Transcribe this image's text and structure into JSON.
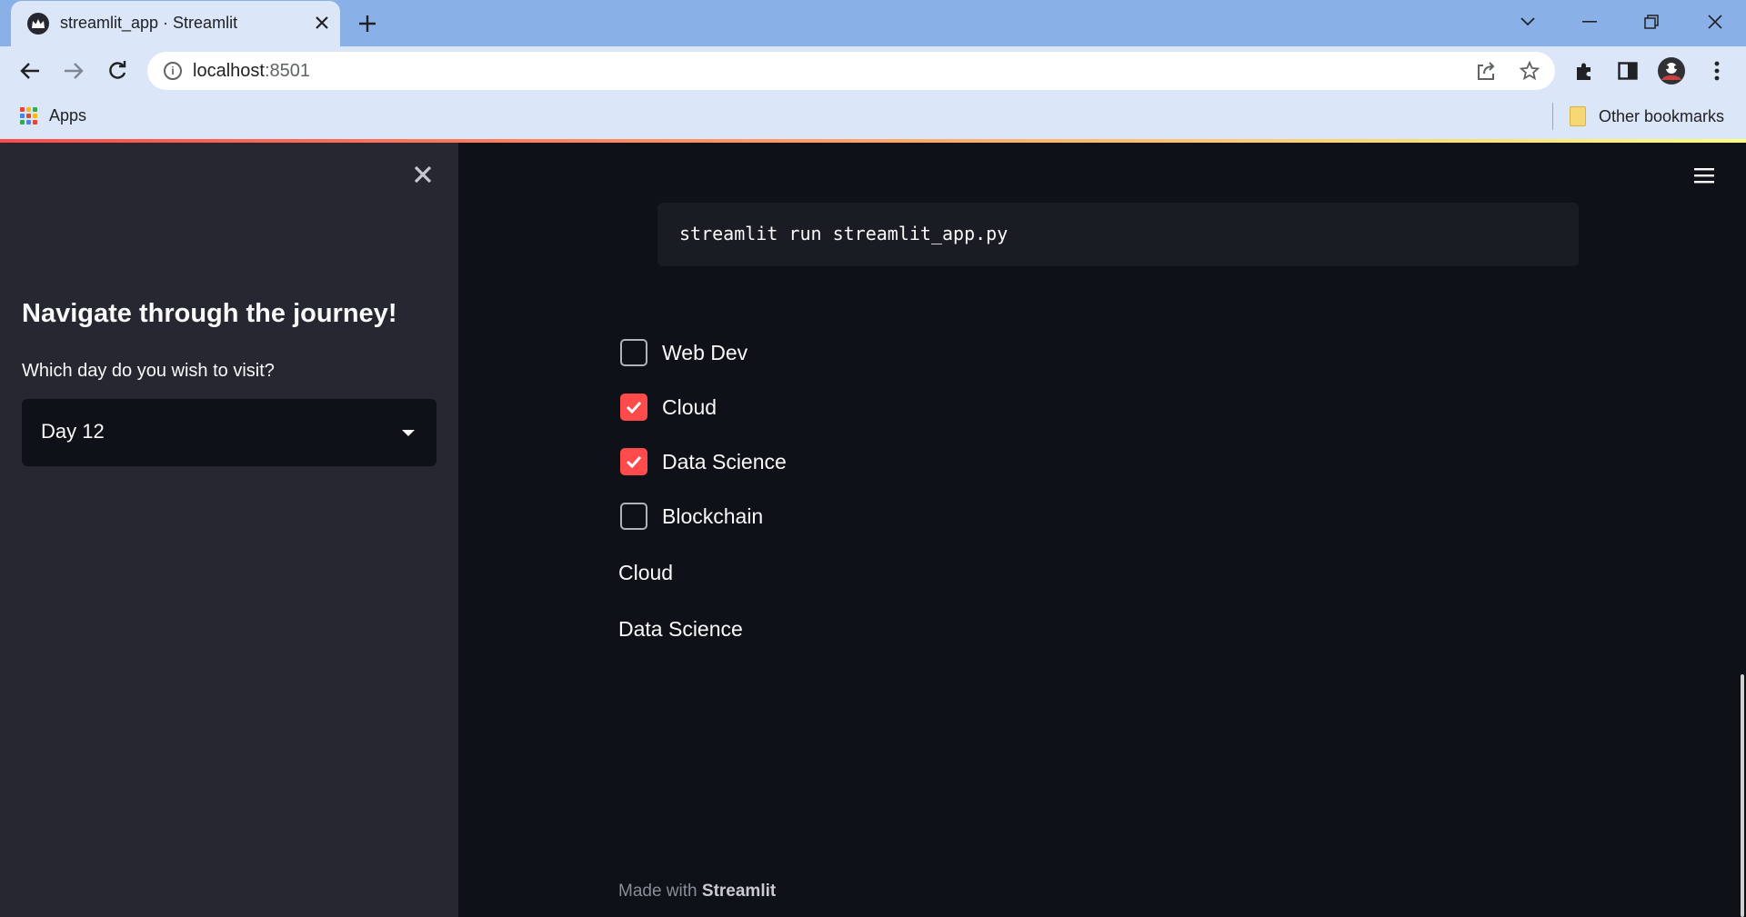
{
  "browser": {
    "tab_title": "streamlit_app · Streamlit",
    "url_host": "localhost",
    "url_port": ":8501",
    "bookmarks": {
      "apps_label": "Apps",
      "other_label": "Other bookmarks"
    }
  },
  "sidebar": {
    "title": "Navigate through the journey!",
    "select_label": "Which day do you wish to visit?",
    "select_value": "Day 12"
  },
  "main": {
    "code": "streamlit run streamlit_app.py",
    "checkboxes": [
      {
        "label": "Web Dev",
        "checked": false
      },
      {
        "label": "Cloud",
        "checked": true
      },
      {
        "label": "Data Science",
        "checked": true
      },
      {
        "label": "Blockchain",
        "checked": false
      }
    ],
    "outputs": [
      "Cloud",
      "Data Science"
    ],
    "footer_prefix": "Made with",
    "footer_brand": "Streamlit"
  },
  "colors": {
    "accent": "#ff4b4b",
    "app_bg": "#0e1117",
    "sidebar_bg": "#262730",
    "code_bg": "#1a1c24",
    "browser_tabstrip": "#8ab0e8",
    "browser_toolbar": "#dbe6f8"
  },
  "icons": {
    "favicon": "streamlit-crown-icon",
    "nav": [
      "back-arrow-icon",
      "forward-arrow-icon",
      "reload-icon"
    ],
    "omnibox": [
      "site-info-icon",
      "share-icon",
      "star-icon"
    ],
    "toolbar": [
      "extensions-icon",
      "side-panel-icon",
      "profile-avatar",
      "kebab-menu-icon"
    ],
    "app": [
      "close-x-icon",
      "hamburger-menu-icon",
      "checkmark-icon",
      "caret-down-icon"
    ]
  }
}
